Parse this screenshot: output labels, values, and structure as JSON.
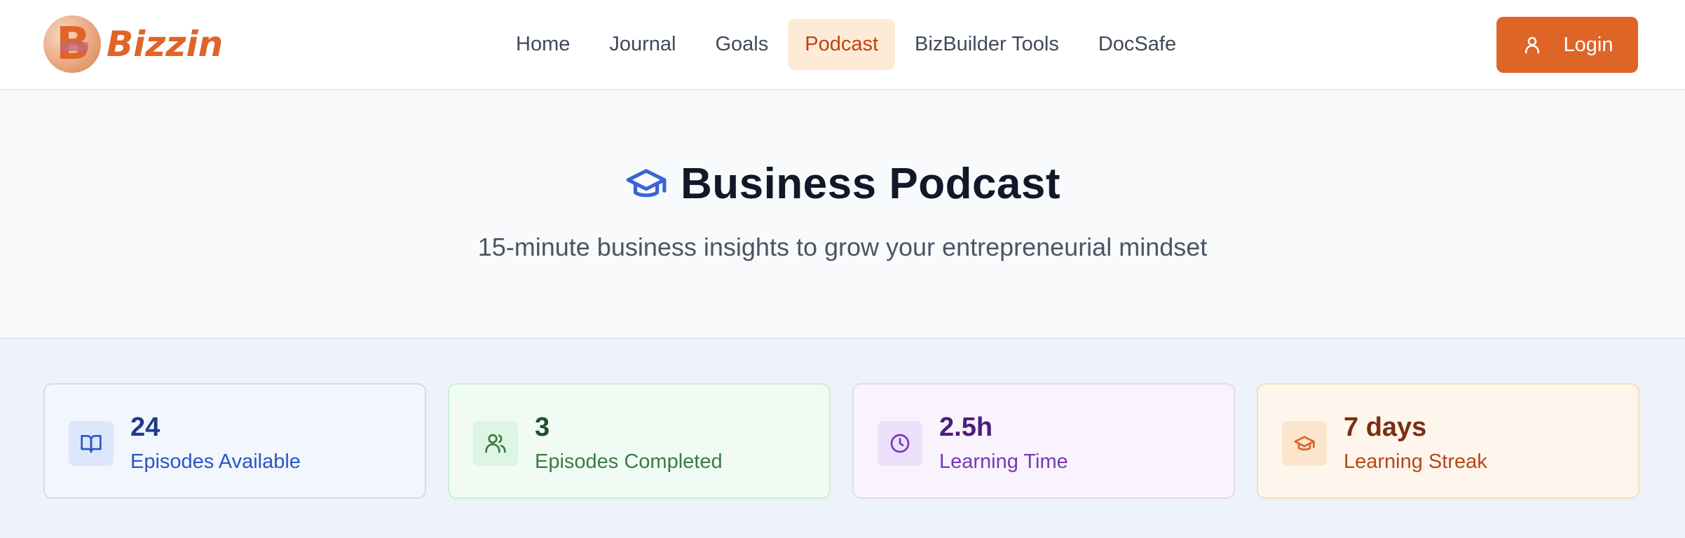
{
  "header": {
    "brand": "Bizzin",
    "brand_initial": "B",
    "nav": [
      {
        "label": "Home",
        "active": false
      },
      {
        "label": "Journal",
        "active": false
      },
      {
        "label": "Goals",
        "active": false
      },
      {
        "label": "Podcast",
        "active": true
      },
      {
        "label": "BizBuilder Tools",
        "active": false
      },
      {
        "label": "DocSafe",
        "active": false
      }
    ],
    "login_label": "Login",
    "login_icon": "user-icon"
  },
  "hero": {
    "icon": "graduation-cap-icon",
    "title": "Business Podcast",
    "subtitle": "15-minute business insights to grow your entrepreneurial mindset"
  },
  "stats": [
    {
      "value": "24",
      "label": "Episodes Available",
      "icon": "book-open-icon",
      "color": "#2b55c6"
    },
    {
      "value": "3",
      "label": "Episodes Completed",
      "icon": "users-icon",
      "color": "#3b7a45"
    },
    {
      "value": "2.5h",
      "label": "Learning Time",
      "icon": "clock-icon",
      "color": "#7a36b8"
    },
    {
      "value": "7 days",
      "label": "Learning Streak",
      "icon": "graduation-cap-icon",
      "color": "#b5471a"
    }
  ],
  "colors": {
    "accent": "#df6527",
    "active_nav_bg": "#fdebd8",
    "hero_icon": "#3b63d8"
  }
}
